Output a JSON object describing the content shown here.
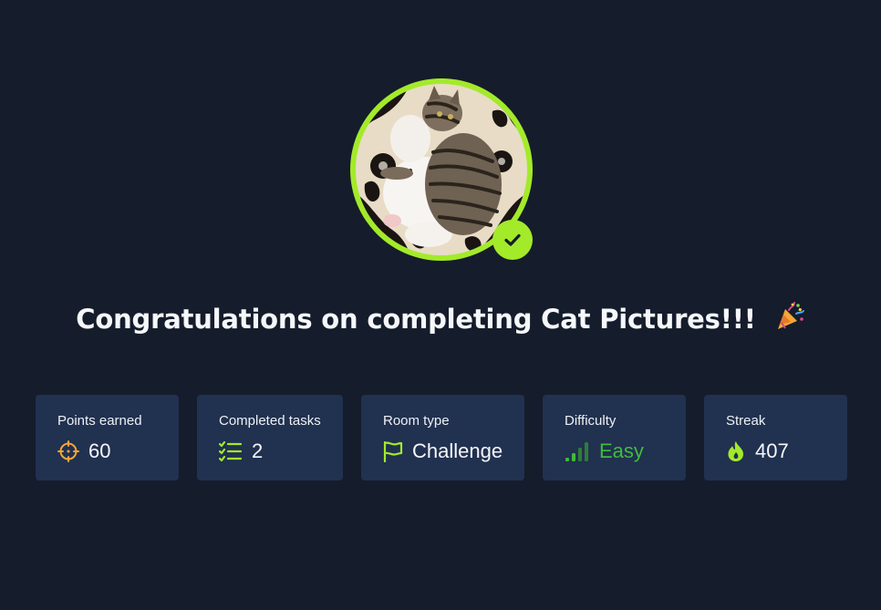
{
  "completion": {
    "title": "Congratulations on completing Cat Pictures!!!",
    "celebration_icon": "party-popper-icon",
    "avatar": {
      "verified_icon": "check-icon",
      "ring_color": "#a3ea2a"
    }
  },
  "stats": [
    {
      "label": "Points earned",
      "value": "60",
      "icon": "crosshair-icon",
      "icon_color": "#f4a637"
    },
    {
      "label": "Completed tasks",
      "value": "2",
      "icon": "checklist-icon",
      "icon_color": "#a3ea2a"
    },
    {
      "label": "Room type",
      "value": "Challenge",
      "icon": "flag-icon",
      "icon_color": "#a3ea2a"
    },
    {
      "label": "Difficulty",
      "value": "Easy",
      "icon": "signal-bars-icon",
      "icon_color": "#3fbc3a"
    },
    {
      "label": "Streak",
      "value": "407",
      "icon": "flame-icon",
      "icon_color": "#a3ea2a"
    }
  ],
  "colors": {
    "background": "#151c2b",
    "card": "#213150",
    "accent": "#a3ea2a",
    "easy": "#3fbc3a"
  }
}
